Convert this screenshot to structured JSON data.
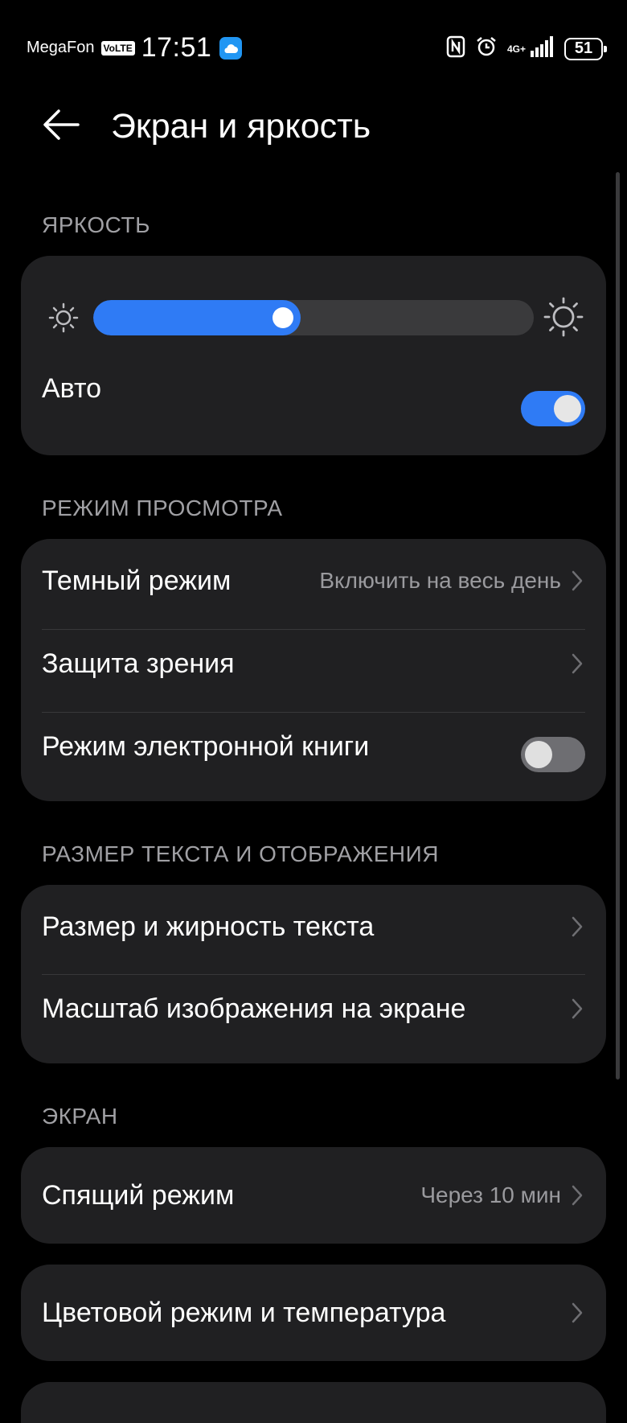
{
  "status_bar": {
    "carrier": "MegaFon",
    "volte": "VoLTE",
    "time": "17:51",
    "network": "4G+",
    "battery": "51"
  },
  "header": {
    "title": "Экран и яркость"
  },
  "brightness": {
    "section_title": "ЯРКОСТЬ",
    "level_percent": 47,
    "auto_label": "Авто",
    "auto_enabled": true
  },
  "view_mode": {
    "section_title": "РЕЖИМ ПРОСМОТРА",
    "dark_mode_label": "Темный режим",
    "dark_mode_value": "Включить на весь день",
    "eye_comfort_label": "Защита зрения",
    "ebook_label": "Режим электронной книги",
    "ebook_enabled": false
  },
  "text_display": {
    "section_title": "РАЗМЕР ТЕКСТА И ОТОБРАЖЕНИЯ",
    "text_size_label": "Размер и жирность текста",
    "display_scale_label": "Масштаб изображения на экране"
  },
  "screen": {
    "section_title": "ЭКРАН",
    "sleep_label": "Спящий режим",
    "sleep_value": "Через 10 мин",
    "color_mode_label": "Цветовой режим и температура"
  },
  "colors": {
    "accent": "#2f7bf5",
    "card": "#202022",
    "background": "#000000"
  }
}
